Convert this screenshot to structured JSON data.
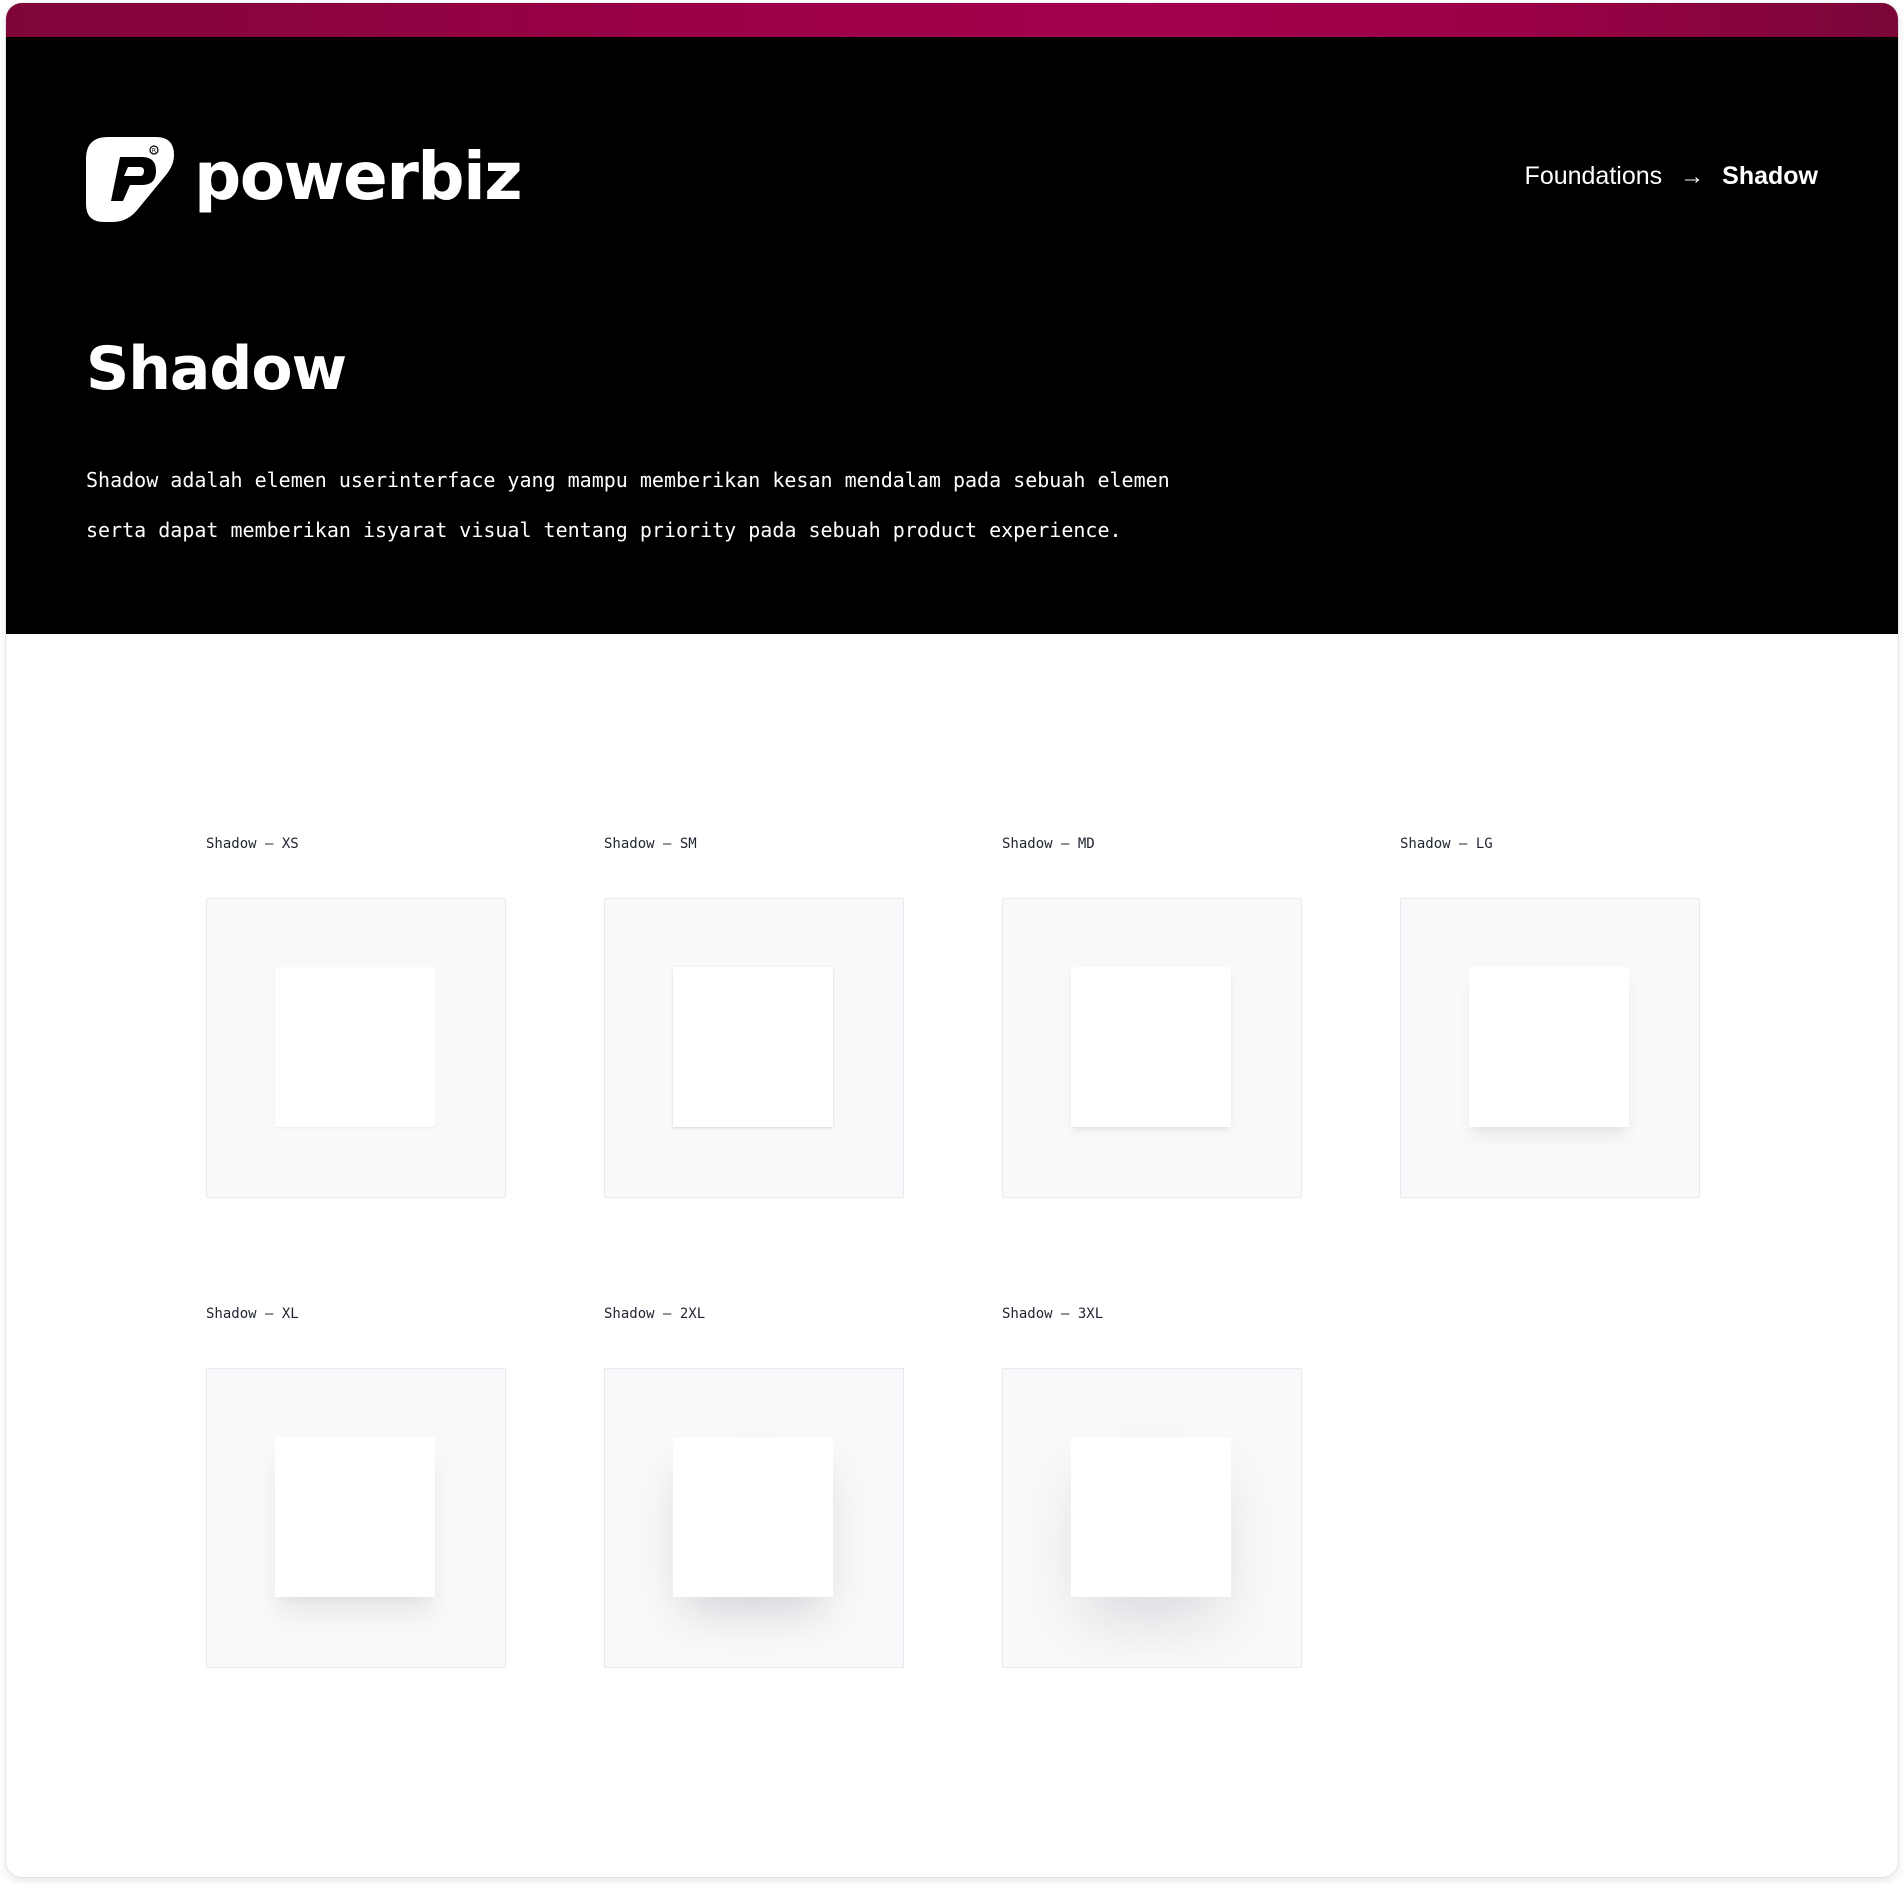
{
  "brand": {
    "name": "powerbiz",
    "icon": "powerbiz-logo-icon",
    "accent_color": "#9a0046"
  },
  "breadcrumb": {
    "parent": "Foundations",
    "separator_icon": "arrow-right-icon",
    "current": "Shadow"
  },
  "hero": {
    "title": "Shadow",
    "description_line1": "Shadow adalah elemen userinterface yang mampu memberikan kesan mendalam pada sebuah elemen",
    "description_line2": "serta dapat memberikan isyarat visual tentang priority pada sebuah product experience."
  },
  "shadows": [
    {
      "label": "Shadow – XS"
    },
    {
      "label": "Shadow – SM"
    },
    {
      "label": "Shadow – MD"
    },
    {
      "label": "Shadow – LG"
    },
    {
      "label": "Shadow – XL"
    },
    {
      "label": "Shadow – 2XL"
    },
    {
      "label": "Shadow – 3XL"
    }
  ]
}
